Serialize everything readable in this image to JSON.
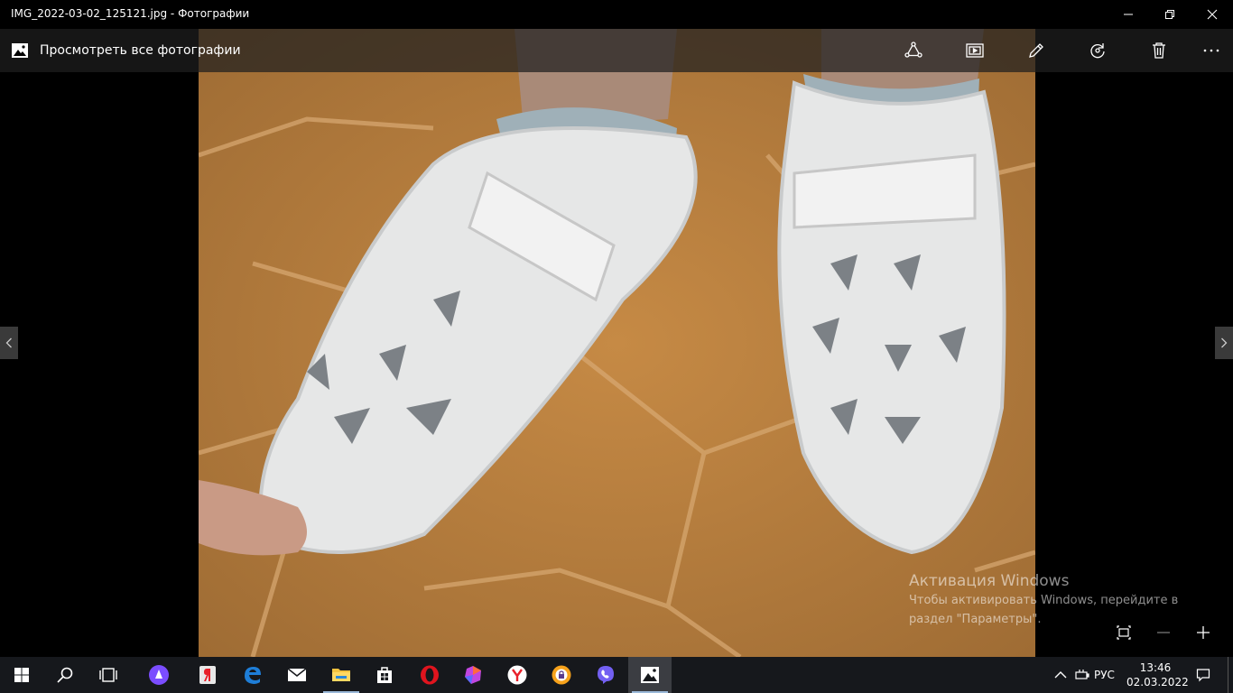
{
  "window": {
    "title": "IMG_2022-03-02_125121.jpg - Фотографии",
    "minimize_icon": "minimize-icon",
    "maximize_icon": "restore-icon",
    "close_icon": "close-icon"
  },
  "toolbar": {
    "back_label": "Просмотреть все фотографии",
    "back_icon": "photos-app-icon",
    "buttons": [
      {
        "name": "share-icon"
      },
      {
        "name": "slideshow-icon"
      },
      {
        "name": "edit-pencil-icon"
      },
      {
        "name": "rotate-icon"
      },
      {
        "name": "delete-icon"
      },
      {
        "name": "more-icon"
      }
    ]
  },
  "navigation": {
    "prev_icon": "chevron-left-icon",
    "next_icon": "chevron-right-icon"
  },
  "activation": {
    "title": "Активация Windows",
    "line1": "Чтобы активировать Windows, перейдите в",
    "line2": "раздел \"Параметры\"."
  },
  "zoom": {
    "fit_icon": "fit-to-window-icon",
    "zoom_out_icon": "zoom-out-icon",
    "zoom_in_icon": "zoom-in-icon"
  },
  "taskbar": {
    "apps": [
      {
        "name": "start-windows-icon"
      },
      {
        "name": "search-icon"
      },
      {
        "name": "task-view-icon"
      },
      {
        "name": "alice-assistant-icon"
      },
      {
        "name": "yandex-browser-icon"
      },
      {
        "name": "edge-icon"
      },
      {
        "name": "mail-icon"
      },
      {
        "name": "file-explorer-icon"
      },
      {
        "name": "store-icon"
      },
      {
        "name": "opera-icon"
      },
      {
        "name": "polygon-app-icon"
      },
      {
        "name": "yandex-icon"
      },
      {
        "name": "brave-lock-icon"
      },
      {
        "name": "viber-icon"
      },
      {
        "name": "photos-app-icon"
      }
    ],
    "tray": {
      "language": "РУС",
      "time": "13:46",
      "date": "02.03.2022"
    }
  }
}
